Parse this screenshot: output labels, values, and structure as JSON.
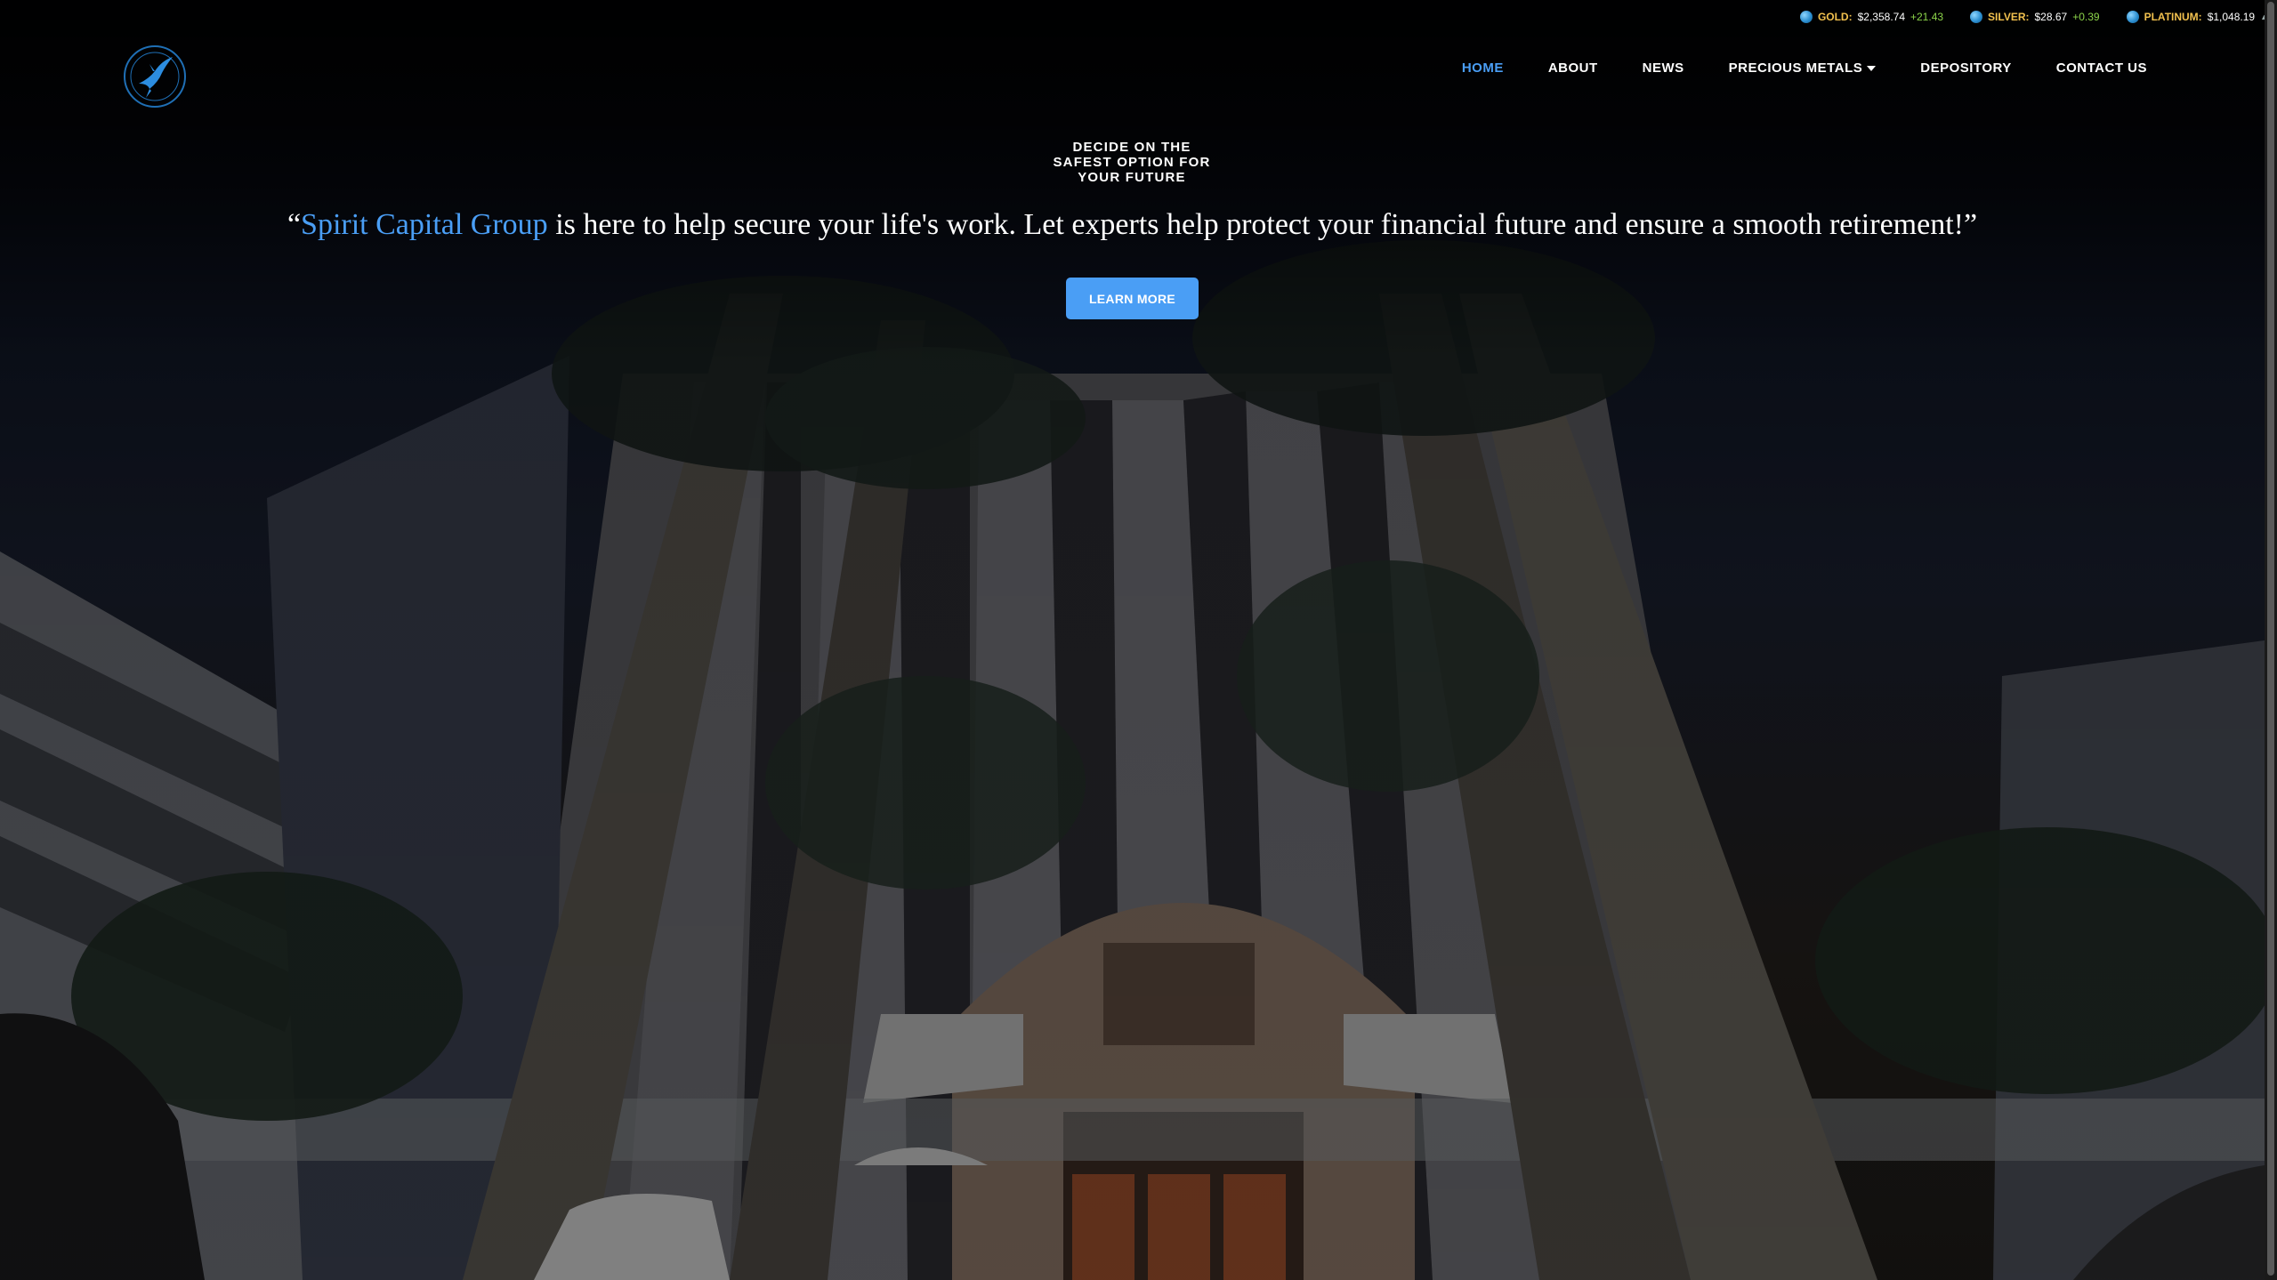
{
  "ticker": [
    {
      "name": "GOLD:",
      "price": "$2,358.74",
      "change": "+21.43"
    },
    {
      "name": "SILVER:",
      "price": "$28.67",
      "change": "+0.39"
    },
    {
      "name": "PLATINUM:",
      "price": "$1,048.19",
      "change": ""
    }
  ],
  "logo": {
    "icon": "hummingbird-logo-icon"
  },
  "nav": {
    "home": "HOME",
    "about": "ABOUT",
    "news": "NEWS",
    "precious_metals": "PRECIOUS METALS",
    "depository": "DEPOSITORY",
    "contact": "CONTACT US"
  },
  "hero": {
    "kicker": "DECIDE ON THE SAFEST OPTION FOR YOUR FUTURE",
    "quote_open": "“",
    "quote_brand": "Spirit Capital Group",
    "quote_rest": " is here to help secure your life's work. Let experts help protect your financial future and ensure a smooth retirement!”",
    "cta": "LEARN MORE"
  },
  "colors": {
    "accent": "#4a9ef5",
    "ticker_name": "#f2c14e",
    "ticker_change": "#8cd44a",
    "background": "#000000"
  }
}
